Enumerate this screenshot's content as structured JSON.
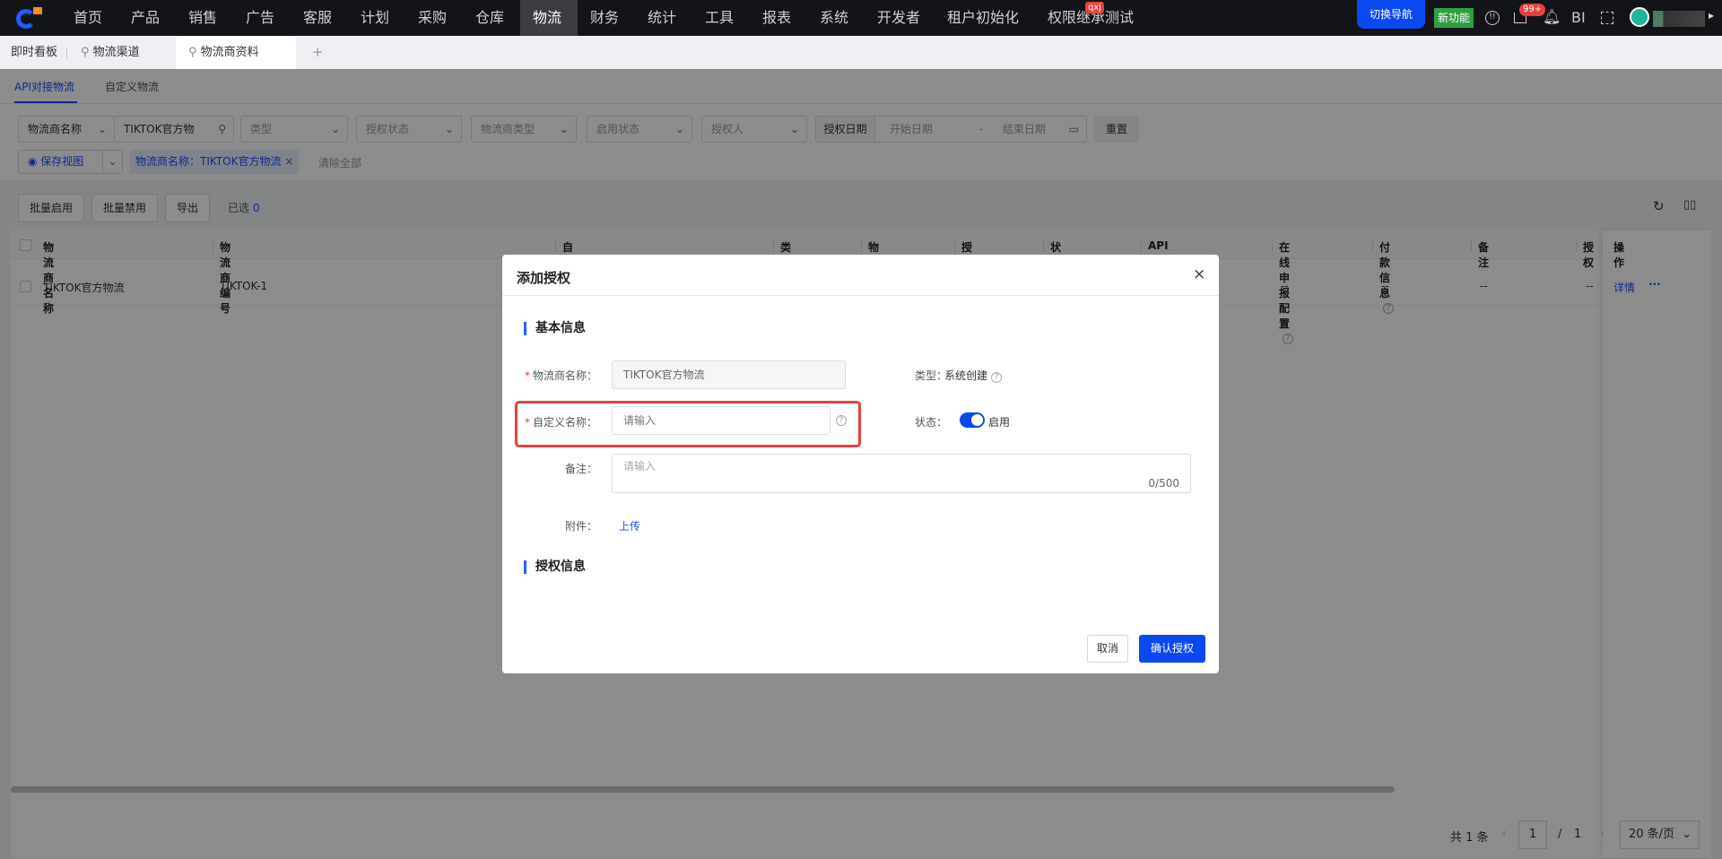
{
  "nav": {
    "items": [
      "首页",
      "产品",
      "销售",
      "广告",
      "客服",
      "计划",
      "采购",
      "仓库",
      "物流",
      "财务",
      "统计",
      "工具",
      "报表",
      "系统",
      "开发者",
      "租户初始化",
      "权限继承测试"
    ],
    "active": "物流",
    "badge_qxj": "qxj",
    "switch_nav": "切换导航",
    "new_feature": "新功能",
    "inbox_badge": "99+",
    "bi": "BI"
  },
  "tabs": {
    "items": [
      "即时看板",
      "物流渠道",
      "物流商资料"
    ],
    "add": "+"
  },
  "subtabs": [
    "API对接物流",
    "自定义物流"
  ],
  "filters": {
    "field_select": "物流商名称",
    "search_value": "TIKTOK官方物",
    "type": "类型",
    "auth_status": "授权状态",
    "carrier_type": "物流商类型",
    "enable_status": "启用状态",
    "authorizer": "授权人",
    "auth_date": "授权日期",
    "start_date": "开始日期",
    "date_sep": "-",
    "end_date": "结束日期",
    "reset": "重置"
  },
  "tags": {
    "save_view": "保存视图",
    "chip": "物流商名称：TIKTOK官方物流",
    "clear_all": "清除全部"
  },
  "toolbar": {
    "batch_enable": "批量启用",
    "batch_disable": "批量禁用",
    "export": "导出",
    "selected_label": "已选",
    "selected_count": "0"
  },
  "table": {
    "headers": [
      "物流商名称",
      "物流商编号",
      "自定义名称",
      "类型",
      "物流商类型",
      "授权状态",
      "状态",
      "API同步物流费用",
      "在线申报配置",
      "付款信息",
      "备注",
      "授权",
      "操作"
    ],
    "rows": [
      {
        "name": "TIKTOK官方物流",
        "code": "TIKTOK-1",
        "online": "--",
        "payment": "--",
        "remark": "--",
        "auth": "--",
        "detail": "详情",
        "more": "···"
      }
    ]
  },
  "pagination": {
    "total": "共 1 条",
    "page": "1",
    "sep": "/",
    "pages": "1",
    "page_size": "20 条/页"
  },
  "modal": {
    "title": "添加授权",
    "section_basic": "基本信息",
    "carrier_name_label": "物流商名称：",
    "carrier_name_value": "TIKTOK官方物流",
    "type_label": "类型：",
    "type_value": "系统创建",
    "custom_name_label": "自定义名称：",
    "custom_name_placeholder": "请输入",
    "status_label": "状态：",
    "status_value": "启用",
    "status_on": true,
    "remark_label": "备注：",
    "remark_placeholder": "请输入",
    "remark_count": "0/500",
    "attachment_label": "附件：",
    "upload": "上传",
    "section_auth": "授权信息",
    "cancel": "取消",
    "confirm": "确认授权"
  },
  "colors": {
    "accent": "#1f4fff",
    "highlight": "#e8413d",
    "new_feature": "#2f9e44"
  }
}
